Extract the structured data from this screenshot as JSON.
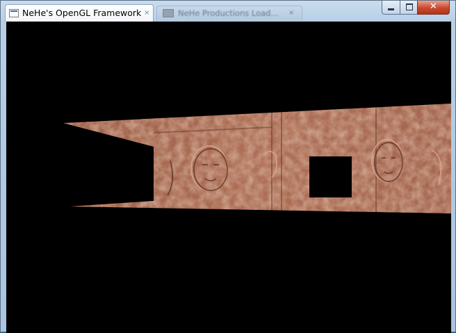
{
  "window": {
    "title": "NeHe's OpenGL Framework",
    "active_tab_close_glyph": "×",
    "inactive_tab_title": "NeHe Productions Load...",
    "inactive_tab_close_glyph": "×",
    "close_glyph": "✕"
  },
  "colors": {
    "client_background": "#000000",
    "texture_base": "#a86a52",
    "texture_light": "#c48a70",
    "texture_dark": "#6e3f2e"
  },
  "icons": {
    "app": "app-window-icon",
    "tab_favicon": "page-favicon-icon",
    "minimize": "minimize-icon",
    "maximize": "maximize-icon",
    "close": "close-icon"
  }
}
